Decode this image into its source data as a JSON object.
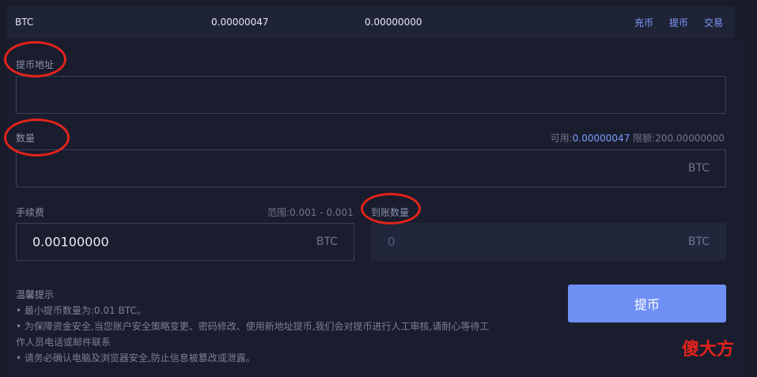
{
  "asset_row": {
    "coin": "BTC",
    "available": "0.00000047",
    "frozen": "0.00000000",
    "actions": [
      "充币",
      "提币",
      "交易"
    ]
  },
  "address": {
    "label": "提币地址",
    "value": ""
  },
  "amount": {
    "label": "数量",
    "available_label": "可用:",
    "available_value": "0.00000047",
    "limit_label": "限额:",
    "limit_value": "200.00000000",
    "unit": "BTC",
    "value": ""
  },
  "fee": {
    "label": "手续费",
    "range": "范围:0.001 - 0.001",
    "value": "0.00100000",
    "unit": "BTC"
  },
  "received": {
    "label": "到账数量",
    "value": "0",
    "unit": "BTC"
  },
  "submit_label": "提币",
  "tips": {
    "title": "温馨提示",
    "lines": [
      "• 最小提币数量为:0.01 BTC。",
      "• 为保障资金安全,当您账户安全策略变更、密码修改、使用新地址提币,我们会对提币进行人工审核,请耐心等待工作人员电话或邮件联系",
      "• 请务必确认电脑及浏览器安全,防止信息被篡改或泄露。"
    ]
  },
  "watermark": "傻大方",
  "colors": {
    "accent": "#7e9cff",
    "button": "#6f8ff5",
    "annotation": "#e3231b"
  }
}
